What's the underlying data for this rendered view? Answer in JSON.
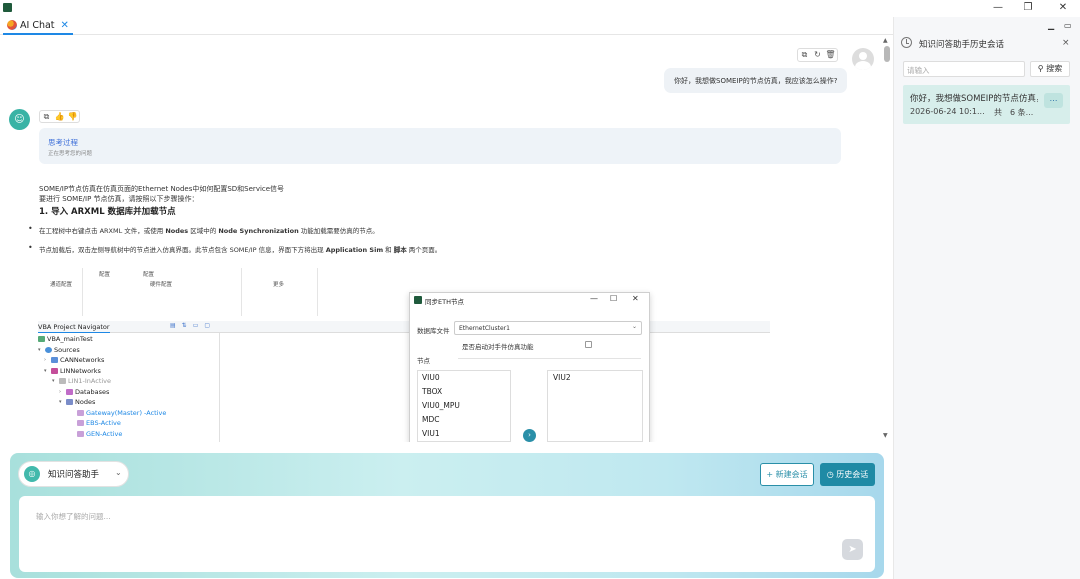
{
  "window": {
    "min": "—",
    "restore": "❐",
    "close": "✕"
  },
  "tab": {
    "label": "AI Chat",
    "close": "✕"
  },
  "chat": {
    "user_message": "你好，我想做SOMEIP的节点仿真，我应该怎么操作?",
    "think_title": "思考过程",
    "think_sub": "正在思考您的问题",
    "answer_line1": "SOME/IP节点仿真在仿真页面的Ethernet Nodes中如何配置SD和Service信号",
    "answer_line2": "要进行 SOME/IP 节点仿真，请按照以下步骤操作：",
    "answer_heading": "1. 导入 ARXML 数据库并加载节点",
    "bullet1_parts": [
      "在工程树中右键点击 ARXML 文件，或使用 ",
      "Nodes",
      " 区域中的 ",
      "Node Synchronization",
      " 功能加载需要仿真的节点。"
    ],
    "bullet2_parts": [
      "节点加载后，双击左侧导航树中的节点进入仿真界面。此节点包含 SOME/IP 信息，界面下方将出现 ",
      "Application Sim",
      " 和 ",
      "脚本",
      " 两个页面。"
    ]
  },
  "embedded": {
    "cfg_top1": "配置",
    "cfg_top2": "配置",
    "cfg_channel": "通道配置",
    "cfg_hardware": "硬件配置",
    "cfg_more": "更多",
    "navigator_title": "VBA Project Navigator",
    "nav_items": [
      "VBA_mainTest",
      "Sources",
      "CANNetworks",
      "LINNetworks",
      "LIN1-InActive",
      "Databases",
      "Nodes",
      "Gateway(Master) -Active",
      "EBS-Active",
      "GEN-Active"
    ],
    "dialog": {
      "title": "同步ETH节点",
      "min": "—",
      "max": "☐",
      "close": "✕",
      "db_label": "数据库文件",
      "db_value": "EthernetCluster1",
      "sim_label": "是否启动对手件仿真功能",
      "nodes_label": "节点",
      "left_nodes": [
        "VIU0",
        "TBOX",
        "VIU0_MPU",
        "MDC",
        "VIU1"
      ],
      "right_nodes": [
        "VIU2"
      ],
      "move_icon": "›"
    }
  },
  "history_panel": {
    "title": "知识问答助手历史会话",
    "search_placeholder": "请输入",
    "search_button": "搜索",
    "items": [
      {
        "title": "你好，我想做SOMEIP的节点仿真，我应该怎么操作?",
        "date": "2026-06-24 10:1...",
        "count": "共　6 条..."
      }
    ]
  },
  "input": {
    "mode_label": "知识问答助手",
    "new_chat": "+ 新建会话",
    "history": "历史会话",
    "placeholder": "输入你想了解的问题..."
  },
  "colors": {
    "accent": "#1f8aa5",
    "link_blue": "#3d6fd9",
    "history_item_bg": "#d7eeeb"
  }
}
